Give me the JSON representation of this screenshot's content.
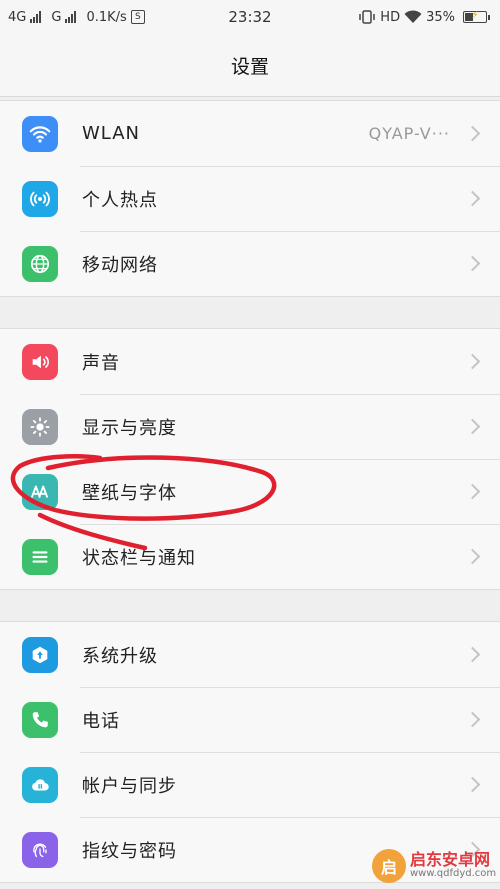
{
  "status_bar": {
    "network_1": "4G",
    "network_2": "G",
    "speed": "0.1K/s",
    "s_badge": "S",
    "time": "23:32",
    "hd": "HD",
    "battery": "35%"
  },
  "header": {
    "title": "设置"
  },
  "groups": [
    [
      {
        "name": "wlan",
        "label": "WLAN",
        "value": "QYAP-V···",
        "icon": "wifi-icon",
        "color": "#3e8ef7"
      },
      {
        "name": "hotspot",
        "label": "个人热点",
        "value": "",
        "icon": "hotspot-icon",
        "color": "#1fa7e8"
      },
      {
        "name": "mobile-network",
        "label": "移动网络",
        "value": "",
        "icon": "globe-icon",
        "color": "#3cc06c"
      }
    ],
    [
      {
        "name": "sound",
        "label": "声音",
        "value": "",
        "icon": "speaker-icon",
        "color": "#f4485c"
      },
      {
        "name": "display",
        "label": "显示与亮度",
        "value": "",
        "icon": "brightness-icon",
        "color": "#9aa0a6"
      },
      {
        "name": "wallpaper",
        "label": "壁纸与字体",
        "value": "",
        "icon": "font-icon",
        "color": "#3bb7b2"
      },
      {
        "name": "status-bar",
        "label": "状态栏与通知",
        "value": "",
        "icon": "list-icon",
        "color": "#3cc06c"
      }
    ],
    [
      {
        "name": "system-update",
        "label": "系统升级",
        "value": "",
        "icon": "update-icon",
        "color": "#1e9be0"
      },
      {
        "name": "phone",
        "label": "电话",
        "value": "",
        "icon": "phone-icon",
        "color": "#3cc06c"
      },
      {
        "name": "accounts",
        "label": "帐户与同步",
        "value": "",
        "icon": "cloud-icon",
        "color": "#27b3d8"
      },
      {
        "name": "fingerprint",
        "label": "指纹与密码",
        "value": "",
        "icon": "fingerprint-icon",
        "color": "#8a63e8"
      }
    ]
  ],
  "watermark": {
    "title": "启东安卓网",
    "url": "www.qdfdyd.com",
    "logo_letter": "启"
  }
}
